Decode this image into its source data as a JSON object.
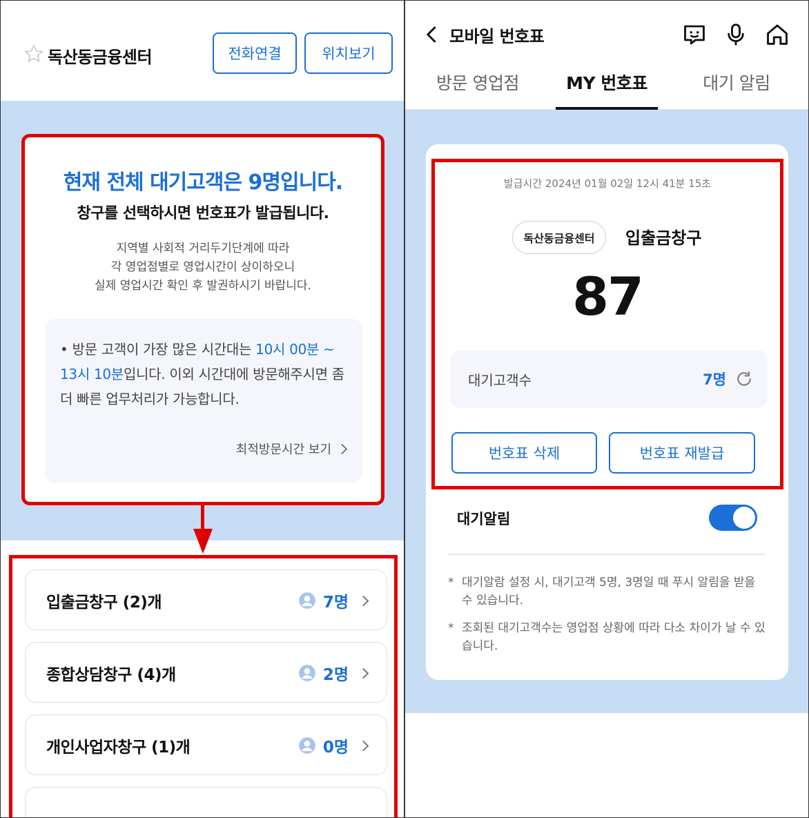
{
  "left": {
    "branch_name": "독산동금융센터",
    "buttons": {
      "call": "전화연결",
      "location": "위치보기"
    },
    "wait_headline": "현재 전체 대기고객은 9명입니다.",
    "wait_sub": "창구를 선택하시면 번호표가 발급됩니다.",
    "notice_lines": [
      "지역별 사회적 거리두기단계에 따라",
      "각 영업점별로 영업시간이 상이하오니",
      "실제 영업시간 확인 후 발권하시기 바랍니다."
    ],
    "tip": {
      "prefix": "방문 고객이 가장 많은 시간대는 ",
      "highlight": "10시 00분 ~ 13시 10분",
      "suffix": "입니다. 이외 시간대에 방문해주시면 좀 더 빠른 업무처리가 가능합니다.",
      "link": "최적방문시간 보기"
    },
    "counters": [
      {
        "name": "입출금창구 (2)개",
        "count": "7명"
      },
      {
        "name": "종합상담창구 (4)개",
        "count": "2명"
      },
      {
        "name": "개인사업자창구 (1)개",
        "count": "0명"
      }
    ]
  },
  "right": {
    "title": "모바일 번호표",
    "tabs": [
      "방문 영업점",
      "MY 번호표",
      "대기 알림"
    ],
    "active_tab": "MY 번호표",
    "issued_at": "발급시간 2024년 01월 02일 12시 41분 15초",
    "branch_pill": "독산동금융센터",
    "counter": "입출금창구",
    "ticket_number": "87",
    "waiting_label": "대기고객수",
    "waiting_value": "7명",
    "buttons": {
      "delete": "번호표 삭제",
      "reissue": "번호표 재발급"
    },
    "alert_label": "대기알림",
    "alert_enabled": true,
    "notes": [
      "대기알람 설정 시, 대기고객 5명, 3명일 때 푸시 알림을 받을 수 있습니다.",
      "조회된 대기고객수는 영업점 상황에 따라 다소 차이가 날 수 있습니다."
    ]
  },
  "colors": {
    "accent": "#1a6fd8",
    "highlight_box": "#e00000",
    "background_blue": "#c7ddf6"
  }
}
